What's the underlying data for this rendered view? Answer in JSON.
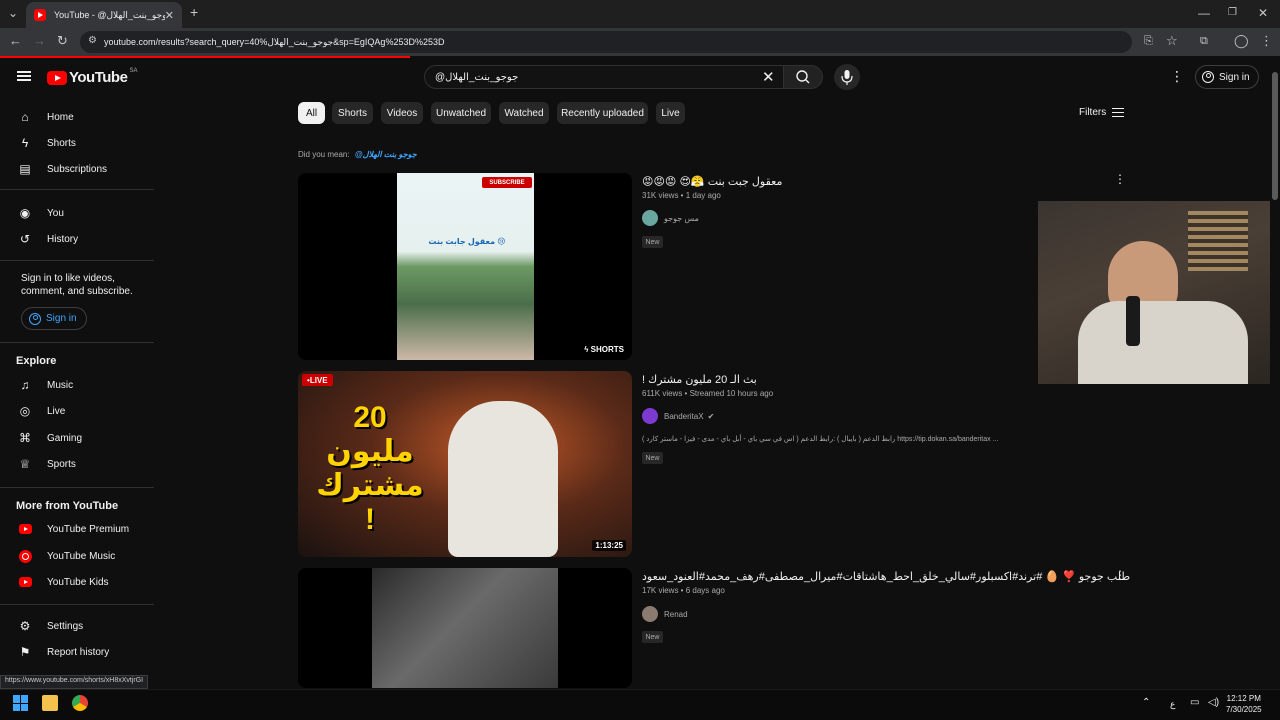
{
  "browser": {
    "tab_title": "YouTube - @جوجو_بنت_الهلال",
    "tab_close": "✕",
    "new_tab": "+",
    "url": "youtube.com/results?search_query=40%جوجو_بنت_الهلال&sp=EgIQAg%253D%253D",
    "window_controls": {
      "minimize": "—",
      "restore": "❐",
      "close": "✕"
    }
  },
  "header": {
    "brand": "YouTube",
    "country": "SA",
    "search_value": "@جوجو_بنت_الهلال",
    "clear_icon": "✕",
    "signin_label": "Sign in"
  },
  "sidebar": {
    "main": [
      {
        "label": "Home",
        "icon": "home-icon"
      },
      {
        "label": "Shorts",
        "icon": "shorts-icon"
      },
      {
        "label": "Subscriptions",
        "icon": "subscriptions-icon"
      }
    ],
    "you": [
      {
        "label": "You",
        "icon": "you-icon"
      },
      {
        "label": "History",
        "icon": "history-icon"
      }
    ],
    "signin_prompt": "Sign in to like videos, comment, and subscribe.",
    "signin_button": "Sign in",
    "explore_heading": "Explore",
    "explore": [
      {
        "label": "Music",
        "icon": "music-icon"
      },
      {
        "label": "Live",
        "icon": "live-icon"
      },
      {
        "label": "Gaming",
        "icon": "gaming-icon"
      },
      {
        "label": "Sports",
        "icon": "sports-icon"
      }
    ],
    "more_heading": "More from YouTube",
    "more": [
      {
        "label": "YouTube Premium",
        "icon": "youtube-premium-icon"
      },
      {
        "label": "YouTube Music",
        "icon": "youtube-music-icon"
      },
      {
        "label": "YouTube Kids",
        "icon": "youtube-kids-icon"
      }
    ],
    "footer": [
      {
        "label": "Settings",
        "icon": "settings-icon"
      },
      {
        "label": "Report history",
        "icon": "flag-icon"
      }
    ]
  },
  "chips": [
    "All",
    "Shorts",
    "Videos",
    "Unwatched",
    "Watched",
    "Recently uploaded",
    "Live"
  ],
  "filters_label": "Filters",
  "did_you_mean": {
    "prefix": "Did you mean:",
    "suggestion": "@جوجو بنت الهلال"
  },
  "results": [
    {
      "title": "😡😡😡 😍😤 معقول جبت بنت",
      "meta": "31K views • 1 day ago",
      "channel": "مس جوجو",
      "badge": "New",
      "thumb_label": "SHORTS",
      "thumb_text_1": "SUBSCRIBE",
      "thumb_text_2": "معقول جابت بنت 😢"
    },
    {
      "title": "! بث الـ 20 مليون مشترك",
      "meta": "611K views • Streamed 10 hours ago",
      "channel": "BanderitaX",
      "description": "رابط الدعم ( بايبال ) :رابط الدعم ( اس في سي باي - أبل باي - مدى - فيزا - ماستر كارد ) https://tip.dokan.sa/banderitax ...",
      "badge": "New",
      "live_label": "LIVE",
      "duration": "1:13:25",
      "thumb_text": "20 مليون مشترك !"
    },
    {
      "title": "طلب جوجو ❣️ 🥚 #ترند#اكسبلور#سالي_خلق_احط_هاشتاقات#ميرال_مصطفى#رهف_محمد#العنود_سعود",
      "meta": "17K views • 6 days ago",
      "channel": "Renad",
      "badge": "New"
    }
  ],
  "status_url": "https://www.youtube.com/shorts/xH8xXvtjrGI",
  "taskbar": {
    "lang": "ع",
    "time": "12:12 PM",
    "date": "7/30/2025"
  },
  "colors": {
    "accent": "#ff0000",
    "link": "#3ea6ff",
    "bg": "#0f0f0f"
  }
}
